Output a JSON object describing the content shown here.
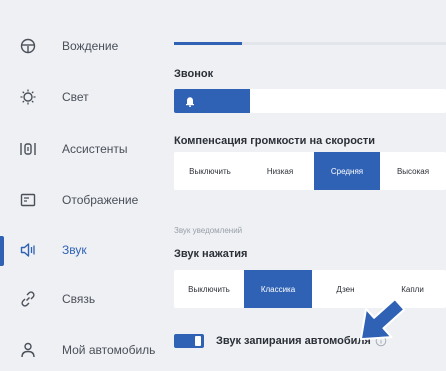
{
  "sidebar": {
    "items": [
      {
        "label": "Вождение",
        "icon": "steering-wheel-icon"
      },
      {
        "label": "Свет",
        "icon": "light-bulb-icon"
      },
      {
        "label": "Ассистенты",
        "icon": "assist-icon"
      },
      {
        "label": "Отображение",
        "icon": "display-icon"
      },
      {
        "label": "Звук",
        "icon": "speaker-icon",
        "active": true
      },
      {
        "label": "Связь",
        "icon": "link-icon"
      },
      {
        "label": "Мой автомобиль",
        "icon": "user-icon"
      }
    ]
  },
  "colors": {
    "accent": "#2f62b5",
    "background": "#eef0f4",
    "panel": "#ffffff",
    "arrow": "#2f62b5"
  },
  "top_progress": {
    "value": 0.25
  },
  "ringtone": {
    "title": "Звонок",
    "icon": "bell-icon",
    "volume": 0.28
  },
  "speed_compensation": {
    "title": "Компенсация громкости на скорости",
    "options": [
      "Выключить",
      "Низкая",
      "Средняя",
      "Высокая"
    ],
    "selected": "Средняя"
  },
  "notification_sound": {
    "subtitle": "Звук уведомлений"
  },
  "tap_sound": {
    "title": "Звук нажатия",
    "options": [
      "Выключить",
      "Классика",
      "Дзен",
      "Капли"
    ],
    "selected": "Классика"
  },
  "lock_sound": {
    "label": "Звук запирания автомобиля",
    "enabled": true,
    "info_icon": "info-icon"
  },
  "annotation": {
    "icon": "pointer-arrow-icon"
  }
}
